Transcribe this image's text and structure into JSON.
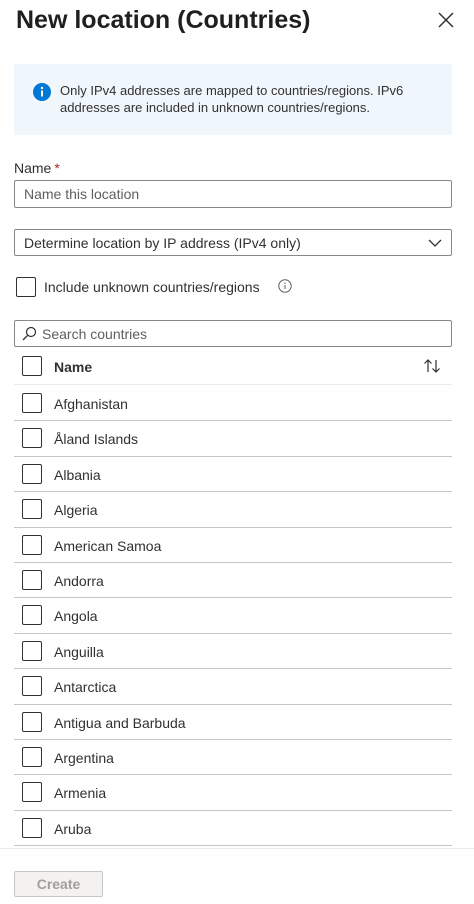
{
  "header": {
    "title": "New location (Countries)"
  },
  "info": {
    "text": "Only IPv4 addresses are mapped to countries/regions. IPv6 addresses are included in unknown countries/regions."
  },
  "name_field": {
    "label": "Name",
    "required_mark": "*",
    "value": "",
    "placeholder": "Name this location"
  },
  "location_method": {
    "selected": "Determine location by IP address (IPv4 only)"
  },
  "include_unknown": {
    "label": "Include unknown countries/regions",
    "checked": false
  },
  "search": {
    "placeholder": "Search countries",
    "value": ""
  },
  "grid": {
    "column_header": "Name",
    "rows": [
      {
        "label": "Afghanistan",
        "checked": false
      },
      {
        "label": "Åland Islands",
        "checked": false
      },
      {
        "label": "Albania",
        "checked": false
      },
      {
        "label": "Algeria",
        "checked": false
      },
      {
        "label": "American Samoa",
        "checked": false
      },
      {
        "label": "Andorra",
        "checked": false
      },
      {
        "label": "Angola",
        "checked": false
      },
      {
        "label": "Anguilla",
        "checked": false
      },
      {
        "label": "Antarctica",
        "checked": false
      },
      {
        "label": "Antigua and Barbuda",
        "checked": false
      },
      {
        "label": "Argentina",
        "checked": false
      },
      {
        "label": "Armenia",
        "checked": false
      },
      {
        "label": "Aruba",
        "checked": false
      }
    ]
  },
  "footer": {
    "create_label": "Create",
    "create_disabled": true
  },
  "icons": {
    "close": "close-icon",
    "info": "info-icon",
    "tooltip": "info-tooltip-icon",
    "search": "search-icon",
    "dropdown": "chevron-down-icon",
    "sort": "sort-icon"
  },
  "colors": {
    "accent": "#0078d4",
    "info_background": "#eff6fc",
    "required": "#a4262c",
    "disabled_text": "#a19f9d"
  }
}
